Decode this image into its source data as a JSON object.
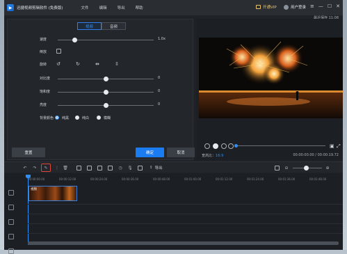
{
  "titlebar": {
    "app_title": "迅捷视频剪辑软件 (免费版)",
    "menu": [
      "文件",
      "编辑",
      "导出",
      "帮助"
    ],
    "vip_label": "开通VIP",
    "login_label": "用户登录",
    "save_status": "最近保存 11:08"
  },
  "editor": {
    "tabs": [
      {
        "label": "视频",
        "active": true
      },
      {
        "label": "音频",
        "active": false
      }
    ],
    "speed": {
      "label": "速度",
      "value": "1.0x",
      "level": 0.18
    },
    "reverse": {
      "label": "倒放",
      "checked": false
    },
    "rotate": {
      "label": "旋转"
    },
    "contrast": {
      "label": "对比度",
      "value": "0",
      "level": 0.5
    },
    "saturation": {
      "label": "饱和度",
      "value": "0",
      "level": 0.5
    },
    "brightness": {
      "label": "亮度",
      "value": "0",
      "level": 0.5
    },
    "bg_color": {
      "label": "背景颜色",
      "options": [
        {
          "label": "纯黑",
          "checked": true
        },
        {
          "label": "纯白",
          "checked": false
        },
        {
          "label": "模糊",
          "checked": false
        }
      ]
    },
    "reset_label": "重置",
    "ok_label": "确定",
    "cancel_label": "取消"
  },
  "preview": {
    "ratio_label": "宽高比：",
    "ratio_value": "16:9",
    "time": "00:00:00.00 / 00:00:19.72",
    "progress": 0.0
  },
  "toolbar": {
    "export_label": "导出",
    "highlighted_tool": "edit-icon"
  },
  "timeline": {
    "ruler": [
      "00:00:00.00",
      "00:00:12.00",
      "00:00:24.00",
      "00:00:36.00",
      "00:00:48.00",
      "00:01:00.00",
      "00:01:12.00",
      "00:01:24.00",
      "00:01:36.00",
      "00:01:48.00",
      "00:02:00.00"
    ],
    "clip_name": "视频"
  },
  "colors": {
    "accent": "#1b7cf2",
    "highlight": "#e2453a",
    "background": "#1f2226"
  }
}
